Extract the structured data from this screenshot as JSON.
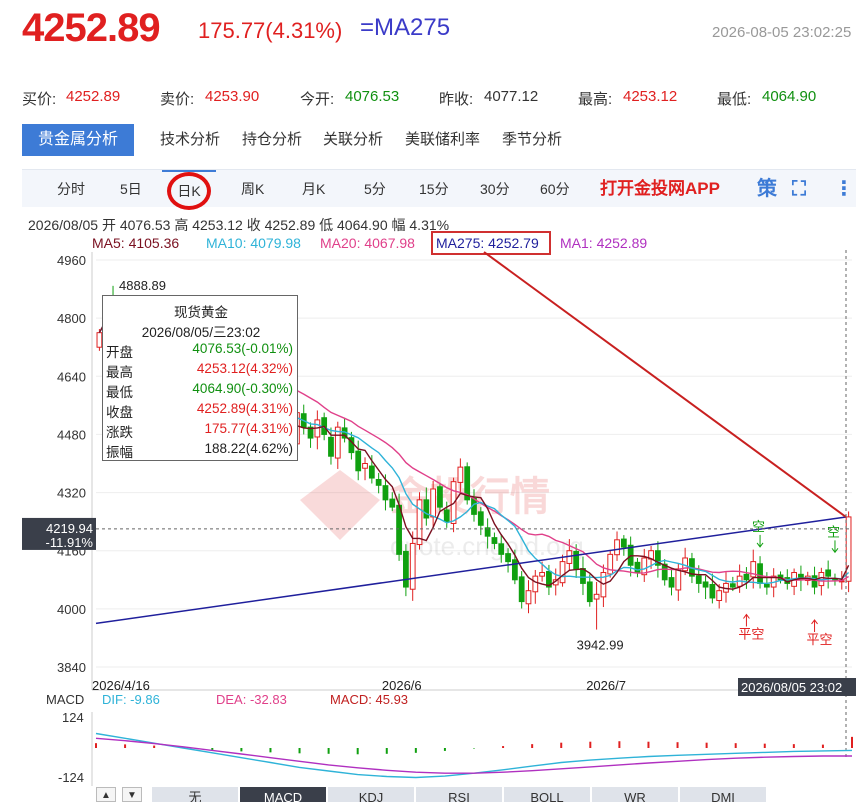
{
  "header": {
    "price": "4252.89",
    "change": "175.77(4.31%)",
    "ma_label": "=MA275",
    "timestamp": "2026-08-05 23:02:25"
  },
  "quote": {
    "bid_label": "买价:",
    "bid": "4252.89",
    "ask_label": "卖价:",
    "ask": "4253.90",
    "open_label": "今开:",
    "open": "4076.53",
    "prev_label": "昨收:",
    "prev": "4077.12",
    "high_label": "最高:",
    "high": "4253.12",
    "low_label": "最低:",
    "low": "4064.90"
  },
  "tabs": [
    "贵金属分析",
    "技术分析",
    "持仓分析",
    "关联分析",
    "美联储利率",
    "季节分析"
  ],
  "periods": [
    "分时",
    "5日",
    "日K",
    "周K",
    "月K",
    "5分",
    "15分",
    "30分",
    "60分"
  ],
  "app_link": "打开金投网APP",
  "tools": {
    "strategy": "策"
  },
  "info": {
    "line1": "2026/08/05  开 4076.53  高 4253.12  收 4252.89  低 4064.90  幅 4.31%",
    "ma5": "MA5: 4105.36",
    "ma10": "MA10: 4079.98",
    "ma20": "MA20: 4067.98",
    "ma275": "MA275: 4252.79",
    "ma1": "MA1: 4252.89"
  },
  "tooltip": {
    "title": "现货黄金",
    "date": "2026/08/05/三23:02",
    "rows": [
      {
        "label": "开盘",
        "value": "4076.53(-0.01%)"
      },
      {
        "label": "最高",
        "value": "4253.12(4.32%)"
      },
      {
        "label": "最低",
        "value": "4064.90(-0.30%)"
      },
      {
        "label": "收盘",
        "value": "4252.89(4.31%)"
      },
      {
        "label": "涨跌",
        "value": "175.77(4.31%)"
      },
      {
        "label": "振幅",
        "value": "188.22(4.62%)"
      }
    ]
  },
  "cursor": {
    "price": "4219.94",
    "pct": "-11.91%",
    "date": "2026/08/05 23:02"
  },
  "watermark": {
    "brand": "金投行情",
    "url": "quote.cngold.org"
  },
  "macd": {
    "title": "MACD",
    "dif": "DIF: -9.86",
    "dea": "DEA: -32.83",
    "macd": "MACD: 45.93",
    "ticks": [
      "124",
      "-124"
    ]
  },
  "bottom_tabs": [
    "无",
    "MACD",
    "KDJ",
    "RSI",
    "BOLL",
    "WR",
    "DMI"
  ],
  "colors": {
    "up": "#e02020",
    "down": "#10a010",
    "ma5": "#7a1020",
    "ma10": "#2fb3d8",
    "ma20": "#e0408a",
    "ma275": "#1f1f9c",
    "annot": "#c82020"
  },
  "chart_data": {
    "type": "candlestick",
    "y_ticks": [
      4960,
      4800,
      4640,
      4480,
      4320,
      4160,
      4000,
      3840
    ],
    "ylim": [
      3840,
      4960
    ],
    "x_labels": [
      "2026/4/16",
      "2026/6",
      "2026/7"
    ],
    "x_label_days": [
      0,
      45,
      75
    ],
    "days_total": 111,
    "high_annotation": {
      "label": "4888.89",
      "value": 4888.89,
      "day": 2
    },
    "low_annotation": {
      "label": "3942.99",
      "value": 3942.99,
      "day": 73
    },
    "signals": [
      {
        "label": "空",
        "day": 97,
        "value": 4165,
        "dir": "down",
        "color": "#10a010"
      },
      {
        "label": "平空",
        "day": 95,
        "value": 3990,
        "dir": "up",
        "color": "#e02020"
      },
      {
        "label": "空",
        "day": 108,
        "value": 4150,
        "dir": "down",
        "color": "#10a010"
      },
      {
        "label": "平空",
        "day": 105,
        "value": 3975,
        "dir": "up",
        "color": "#e02020"
      }
    ],
    "closes": [
      4760,
      4830,
      4700,
      4780,
      4800,
      4740,
      4700,
      4790,
      4760,
      4720,
      4700,
      4690,
      4740,
      4770,
      4700,
      4660,
      4630,
      4600,
      4650,
      4620,
      4580,
      4560,
      4540,
      4560,
      4500,
      4530,
      4480,
      4510,
      4460,
      4540,
      4500,
      4470,
      4520,
      4480,
      4420,
      4500,
      4470,
      4430,
      4380,
      4400,
      4360,
      4340,
      4300,
      4280,
      4150,
      4060,
      4180,
      4300,
      4250,
      4330,
      4280,
      4240,
      4350,
      4390,
      4300,
      4260,
      4230,
      4200,
      4180,
      4150,
      4130,
      4080,
      4020,
      4050,
      4090,
      4100,
      4060,
      4080,
      4130,
      4160,
      4110,
      4070,
      4020,
      4040,
      4100,
      4150,
      4190,
      4170,
      4120,
      4100,
      4140,
      4160,
      4120,
      4080,
      4060,
      4110,
      4140,
      4090,
      4070,
      4060,
      4030,
      4050,
      4070,
      4060,
      4090,
      4080,
      4130,
      4070,
      4060,
      4090,
      4080,
      4070,
      4100,
      4080,
      4090,
      4060,
      4100,
      4090,
      4080,
      4077,
      4253
    ],
    "ma275": {
      "start": 3960,
      "end": 4252.79
    },
    "macd": {
      "ylim": [
        -124,
        124
      ],
      "dif": [
        60,
        40,
        20,
        0,
        -20,
        -40,
        -60,
        -80,
        -95,
        -110,
        -118,
        -122,
        -116,
        -104,
        -90,
        -75,
        -60,
        -50,
        -42,
        -35,
        -30,
        -26,
        -22,
        -18,
        -14,
        -12,
        -10
      ],
      "dea": [
        40,
        30,
        18,
        5,
        -10,
        -25,
        -40,
        -55,
        -70,
        -82,
        -92,
        -100,
        -104,
        -104,
        -100,
        -94,
        -86,
        -78,
        -70,
        -62,
        -55,
        -48,
        -42,
        -38,
        -35,
        -33,
        -33
      ],
      "hist": [
        20,
        15,
        10,
        5,
        -8,
        -14,
        -18,
        -22,
        -24,
        -26,
        -24,
        -20,
        -12,
        -2,
        8,
        16,
        22,
        26,
        28,
        26,
        24,
        22,
        20,
        18,
        16,
        14,
        46
      ]
    }
  }
}
